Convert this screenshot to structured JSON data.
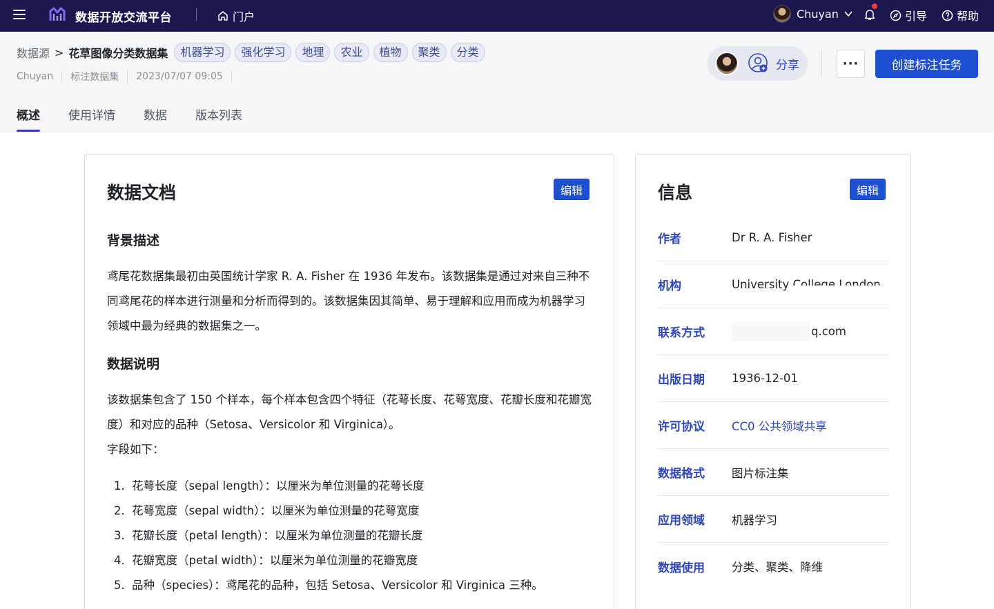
{
  "topbar": {
    "app_title": "数据开放交流平台",
    "portal_label": "门户",
    "user_name": "Chuyan",
    "guide_label": "引导",
    "help_label": "帮助"
  },
  "header": {
    "breadcrumb_root": "数据源",
    "breadcrumb_sep": ">",
    "dataset_title": "花草图像分类数据集",
    "tags": [
      "机器学习",
      "强化学习",
      "地理",
      "农业",
      "植物",
      "聚类",
      "分类"
    ],
    "meta": [
      "Chuyan",
      "标注数据集",
      "2023/07/07 09:05"
    ],
    "share_label": "分享",
    "more_label": "···",
    "create_button": "创建标注任务"
  },
  "tabs": [
    "概述",
    "使用详情",
    "数据",
    "版本列表"
  ],
  "doc": {
    "title": "数据文档",
    "edit_label": "编辑",
    "section1_title": "背景描述",
    "section1_text": "鸢尾花数据集最初由英国统计学家 R. A. Fisher 在 1936 年发布。该数据集是通过对来自三种不同鸢尾花的样本进行测量和分析而得到的。该数据集因其简单、易于理解和应用而成为机器学习领域中最为经典的数据集之一。",
    "section2_title": "数据说明",
    "section2_text": "该数据集包含了 150 个样本，每个样本包含四个特征（花萼长度、花萼宽度、花瓣长度和花瓣宽度）和对应的品种（Setosa、Versicolor 和 Virginica）。",
    "fields_intro": "字段如下：",
    "fields": [
      {
        "num": "1.",
        "text": "花萼长度（sepal length）：以厘米为单位测量的花萼长度"
      },
      {
        "num": "2.",
        "text": "花萼宽度（sepal width）：以厘米为单位测量的花萼宽度"
      },
      {
        "num": "3.",
        "text": "花瓣长度（petal length）：以厘米为单位测量的花瓣长度"
      },
      {
        "num": "4.",
        "text": "花瓣宽度（petal width）：以厘米为单位测量的花瓣宽度"
      },
      {
        "num": "5.",
        "text": "品种（species）：鸢尾花的品种，包括 Setosa、Versicolor 和 Virginica 三种。"
      }
    ]
  },
  "info": {
    "title": "信息",
    "edit_label": "编辑",
    "rows": [
      {
        "label": "作者",
        "value": "Dr R. A. Fisher"
      },
      {
        "label": "机构",
        "value": "University College London"
      },
      {
        "label": "联系方式",
        "value": "q.com"
      },
      {
        "label": "出版日期",
        "value": "1936-12-01"
      },
      {
        "label": "许可协议",
        "value": "CC0 公共领域共享"
      },
      {
        "label": "数据格式",
        "value": "图片标注集"
      },
      {
        "label": "应用领域",
        "value": "机器学习"
      },
      {
        "label": "数据使用",
        "value": "分类、聚类、降维"
      }
    ]
  },
  "colors": {
    "navbar_bg": "#1b1850",
    "primary": "#1f4fd1",
    "label_blue": "#2f47b8",
    "notification_dot": "#f23b3b"
  },
  "icons": [
    "menu-icon",
    "logo-icon",
    "home-icon",
    "chevron-down-icon",
    "bell-icon",
    "compass-icon",
    "help-circle-icon",
    "add-user-icon"
  ]
}
